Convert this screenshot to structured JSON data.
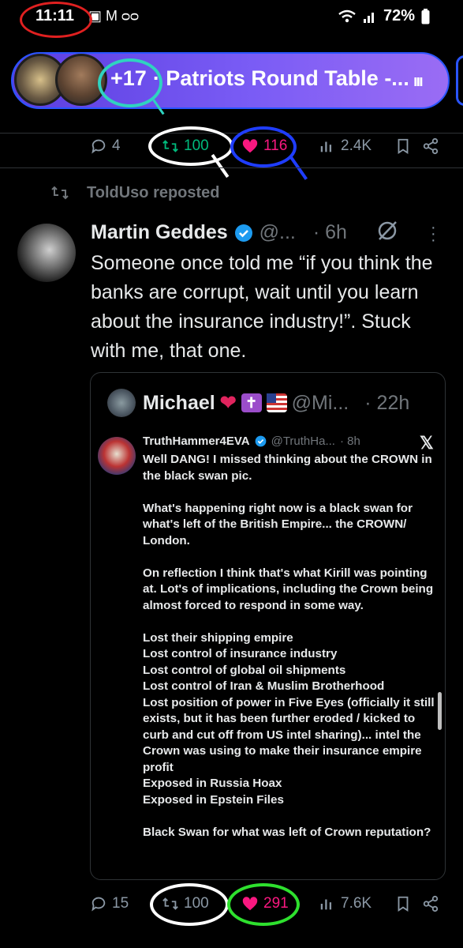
{
  "status_bar": {
    "time": "11:11",
    "notifications": "▣ M ᴑᴑ",
    "battery": "72%"
  },
  "spaces_bar": {
    "listener_count": "+17",
    "title": "· Patriots Round Table -..."
  },
  "prev_tweet_actions": {
    "replies": "4",
    "reposts": "100",
    "likes": "116",
    "views": "2.4K"
  },
  "repost_header": {
    "text": "ToldUso reposted"
  },
  "tweet": {
    "author_name": "Martin Geddes",
    "handle": "@...",
    "time": "· 6h",
    "text": "Someone once told me “if you think the banks are corrupt, wait until you learn about the insurance industry!”. Stuck with me, that one.",
    "actions": {
      "replies": "15",
      "reposts": "100",
      "likes": "291",
      "views": "7.6K"
    }
  },
  "quote": {
    "author_name": "Michael",
    "handle": "@Mi...",
    "time": "· 22h",
    "inner_author": "TruthHammer4EVA",
    "inner_handle": "@TruthHa...",
    "inner_time": "· 8h",
    "inner_body": "Well DANG! I missed thinking about the CROWN in the black swan pic.\n\nWhat's happening right now is a black swan for what's left of the British Empire... the CROWN/ London.\n\nOn reflection I think that's what Kirill was pointing at. Lot's of implications, including the Crown being almost forced to respond in some way.\n\nLost their shipping empire\nLost control of insurance industry\nLost control of global oil shipments\nLost control of Iran & Muslim Brotherhood\nLost position of power in Five Eyes (officially it still exists, but it has been further eroded / kicked to curb and cut off from US intel sharing)... intel the Crown was using to make their insurance empire profit\nExposed in Russia Hoax\nExposed in Epstein Files\n\nBlack Swan for what was left of Crown reputation?"
  },
  "colors": {
    "accent_blue": "#1d9bf0",
    "repost_green": "#00ba7c",
    "like_pink": "#f91880",
    "muted": "#71767b"
  },
  "icons": [
    "reply-icon",
    "repost-icon",
    "heart-icon",
    "views-icon",
    "bookmark-icon",
    "share-icon",
    "verified-icon",
    "grok-icon",
    "more-icon",
    "x-logo-icon",
    "wifi-icon",
    "signal-icon",
    "battery-icon"
  ]
}
